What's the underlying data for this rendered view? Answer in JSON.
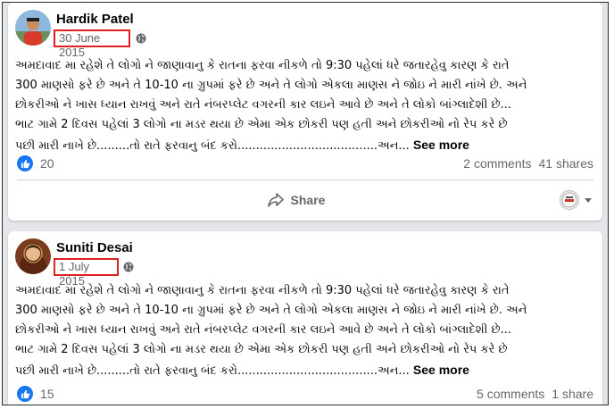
{
  "posts": [
    {
      "author": "Hardik Patel",
      "date": "30 June 2015",
      "lines": [
        "અમદાવાદ મા રહેશે તે લોગો ને જાણાવાનુ કે રાતના ફરવા નીકળે તો 9:30 પહેલાં ધરે જતારહેવુ કારણ કે રાતે",
        "300 માણસો ફરે છે અને તે 10-10 ના ગ્રુપમાં ફરે છે અને તે લોગો એકલા માણસ ને જોઇ ને મારી નાંખે છે. અને",
        "છોકરીઓ ને ખાસ ધ્યાન રાખવું અને રાતે નંબરપ્લેટ વગરની કાર લઇને આવે છે અને તે લોકો બાંગ્લાદેશી છે...",
        "ભાટ ગામે 2 દિવસ પહેલાં 3 લોગો ના મડર થયા છે એમા એક છોકરી પણ હતી અને છોકરીઓ નો રેપ કરે છે",
        "પછી મારી નાખે છે.........તો રાતે ફરવાનુ બંદ કરો......................................અન..."
      ],
      "see_more": "See more",
      "reaction_count": "20",
      "comments": "2 comments",
      "shares": "41 shares",
      "share_label": "Share"
    },
    {
      "author": "Suniti Desai",
      "date": "1 July 2015",
      "lines": [
        "અમદાવાદ મા રહેશે તે લોગો ને જાણાવાનુ કે રાતના ફરવા નીકળે તો 9:30 પહેલાં ધરે જતારહેવુ કારણ કે રાતે",
        "300 માણસો ફરે છે અને તે 10-10 ના ગ્રુપમાં ફરે છે અને તે લોગો એકલા માણસ ને જોઇ ને મારી નાંખે છે. અને",
        "છોકરીઓ ને ખાસ ધ્યાન રાખવું અને રાતે નંબરપ્લેટ વગરની કાર લઇને આવે છે અને તે લોકો બાંગ્લાદેશી છે...",
        "ભાટ ગામે 2 દિવસ પહેલાં 3 લોગો ના મડર થયા છે એમા એક છોકરી પણ હતી અને છોકરીઓ નો રેપ કરે છે",
        "પછી મારી નાખે છે.........તો રાતે ફરવાનુ બંદ કરો......................................અન..."
      ],
      "see_more": "See more",
      "reaction_count": "15",
      "comments": "5 comments",
      "shares": "1 share"
    }
  ],
  "icons": {
    "visibility": "globe-icon",
    "reaction": "like-icon",
    "share": "share-arrow-icon",
    "audience": "audience-selector-icon"
  },
  "colors": {
    "highlight_box": "#e02020",
    "like_blue": "#1877f2",
    "muted_text": "#65676b"
  }
}
